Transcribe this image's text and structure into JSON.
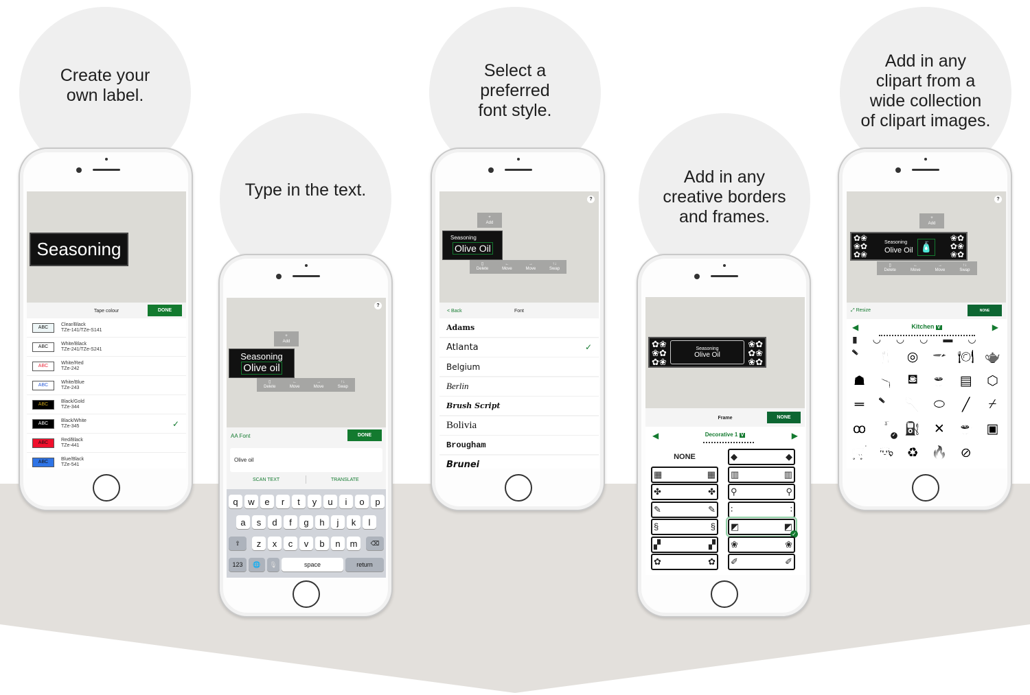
{
  "colors": {
    "accent": "#137a2f",
    "band": "#e3e0dc",
    "bubble": "#efefef"
  },
  "steps": [
    {
      "caption": "Create your\nown label."
    },
    {
      "caption": "Type in the text."
    },
    {
      "caption": "Select a\npreferred\nfont style."
    },
    {
      "caption": "Add in any\ncreative borders\nand frames."
    },
    {
      "caption": "Add in any\nclipart from a\nwide collection\nof clipart images."
    }
  ],
  "phone1": {
    "label_text": "Seasoning",
    "toolbar_title": "Tape colour",
    "done_label": "DONE",
    "swatch_text": "ABC",
    "tapes": [
      {
        "name": "Clear/Black",
        "code": "TZe-141/TZe-S141",
        "bg": "#eef6f7",
        "fg": "#111",
        "selected": false
      },
      {
        "name": "White/Black",
        "code": "TZe-241/TZe-S241",
        "bg": "#ffffff",
        "fg": "#111",
        "selected": false
      },
      {
        "name": "White/Red",
        "code": "TZe-242",
        "bg": "#ffffff",
        "fg": "#e8283a",
        "selected": false
      },
      {
        "name": "White/Blue",
        "code": "TZe-243",
        "bg": "#ffffff",
        "fg": "#2a5bd7",
        "selected": false
      },
      {
        "name": "Black/Gold",
        "code": "TZe-344",
        "bg": "#000000",
        "fg": "#c9a21a",
        "selected": false
      },
      {
        "name": "Black/White",
        "code": "TZe-345",
        "bg": "#000000",
        "fg": "#ffffff",
        "selected": true
      },
      {
        "name": "Red/Black",
        "code": "TZe-441",
        "bg": "#f0102c",
        "fg": "#111",
        "selected": false
      },
      {
        "name": "Blue/Black",
        "code": "TZe-541",
        "bg": "#2f74e6",
        "fg": "#111",
        "selected": false
      }
    ]
  },
  "editor": {
    "help": "?",
    "add": "Add",
    "delete": "Delete",
    "move_left": "Move",
    "move_right": "Move",
    "swap": "Swap"
  },
  "phone2": {
    "line1": "Seasoning",
    "line2": "Olive oil",
    "font_button": "Font",
    "font_icon": "AA",
    "done_label": "DONE",
    "input_value": "Olive oil",
    "scan_text": "SCAN TEXT",
    "translate": "TRANSLATE",
    "keyboard": {
      "row1": [
        "q",
        "w",
        "e",
        "r",
        "t",
        "y",
        "u",
        "i",
        "o",
        "p"
      ],
      "row2": [
        "a",
        "s",
        "d",
        "f",
        "g",
        "h",
        "j",
        "k",
        "l"
      ],
      "row3": [
        "z",
        "x",
        "c",
        "v",
        "b",
        "n",
        "m"
      ],
      "numbers": "123",
      "space": "space",
      "return": "return"
    }
  },
  "phone3": {
    "line1": "Seasoning",
    "line2": "Olive Oil",
    "back": "< Back",
    "title": "Font",
    "fonts": [
      {
        "name": "Adams",
        "selected": false
      },
      {
        "name": "Atlanta",
        "selected": true
      },
      {
        "name": "Belgium",
        "selected": false
      },
      {
        "name": "Berlin",
        "selected": false
      },
      {
        "name": "Brush Script",
        "selected": false
      },
      {
        "name": "Bolivia",
        "selected": false
      },
      {
        "name": "Brougham",
        "selected": false
      },
      {
        "name": "Brunei",
        "selected": false
      }
    ]
  },
  "phone4": {
    "line1": "Seasoning",
    "line2": "Olive Oil",
    "title": "Frame",
    "none_button": "NONE",
    "category": "Decorative 1",
    "dropdown": "V",
    "none_option": "NONE",
    "selected_frame": 9
  },
  "phone5": {
    "line1": "Seasoning",
    "line2": "Olive Oil",
    "resize": "Resize",
    "none_button": "NONE",
    "category": "Kitchen",
    "dropdown": "V",
    "clipart": [
      "knife-icon",
      "fork-icon",
      "plates-icon",
      "whisk-bowl-icon",
      "place-setting-icon",
      "teapot-icon",
      "teapot-solid-icon",
      "pitcher-icon",
      "kettle-icon",
      "teacup-icon",
      "steamer-icon",
      "box-icon",
      "chopsticks-icon",
      "cleaver-icon",
      "ladle-icon",
      "dish-icon",
      "spatula-knife-icon",
      "spatula-icon",
      "measuring-spoons-icon",
      "bottles-icon",
      "measuring-cup-icon",
      "crossed-utensils-icon",
      "hot-cup-icon",
      "mug-icon",
      "cart-icon",
      "chef-hat-icon",
      "recycle-icon",
      "flame-icon",
      "no-fire-icon"
    ],
    "clipart_glyphs": [
      "🔪",
      "🍴",
      "◎",
      "🥣",
      "🍽",
      "🫖",
      "☗",
      "🫗",
      "⛾",
      "☕",
      "▤",
      "⬡",
      "═",
      "🔪",
      "🥄",
      "⬭",
      "╱",
      "⌿",
      "ꝏ",
      "🧴",
      "⛽",
      "✕",
      "☕",
      "▣",
      "🛒",
      "👨‍🍳",
      "♻",
      "🔥",
      "⊘"
    ],
    "selected_clipart": 19
  }
}
